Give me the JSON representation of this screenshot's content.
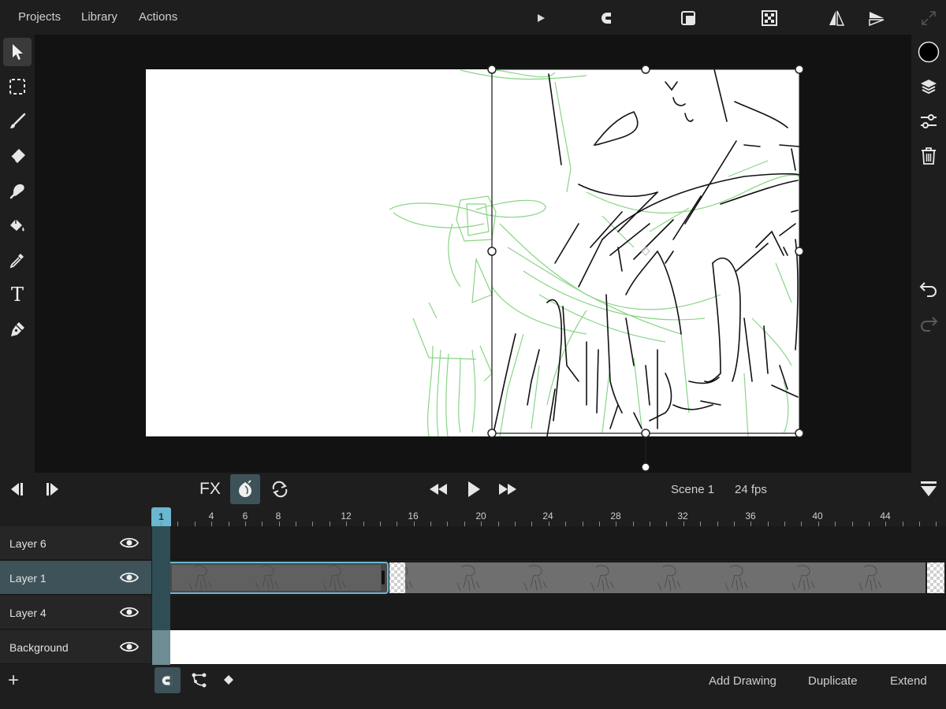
{
  "menu": {
    "projects": "Projects",
    "library": "Library",
    "actions": "Actions"
  },
  "colors": {
    "accent": "#6ab7cf",
    "active_layer": "#3e5259",
    "sketch_green": "#7ed07a",
    "sketch_black": "#111111"
  },
  "icons": {
    "top": [
      "play-small-icon",
      "magnet-icon",
      "frame-icon",
      "grid-icon",
      "flip-horizontal-icon",
      "flip-vertical-icon",
      "fullscreen-icon"
    ],
    "left": [
      "select-arrow-icon",
      "marquee-select-icon",
      "brush-icon",
      "eraser-icon",
      "smudge-icon",
      "fill-bucket-icon",
      "eyedropper-icon",
      "text-icon",
      "pen-nib-icon"
    ],
    "right": [
      "color-swatch-icon",
      "layers-icon",
      "adjust-sliders-icon",
      "trash-icon",
      "undo-icon",
      "redo-icon"
    ]
  },
  "tools": {
    "text_glyph": "T"
  },
  "transport": {
    "fx": "FX",
    "scene": "Scene 1",
    "fps": "24 fps"
  },
  "timeline": {
    "current_frame": "1",
    "ticks": [
      "4",
      "6",
      "8",
      "12",
      "16",
      "20",
      "24",
      "28",
      "32",
      "36",
      "40",
      "44"
    ],
    "layers": [
      {
        "name": "Layer 6",
        "active": false
      },
      {
        "name": "Layer 1",
        "active": true
      },
      {
        "name": "Layer 4",
        "active": false
      },
      {
        "name": "Background",
        "active": false
      }
    ]
  },
  "bottom": {
    "add": "+",
    "add_drawing": "Add Drawing",
    "duplicate": "Duplicate",
    "extend": "Extend"
  }
}
